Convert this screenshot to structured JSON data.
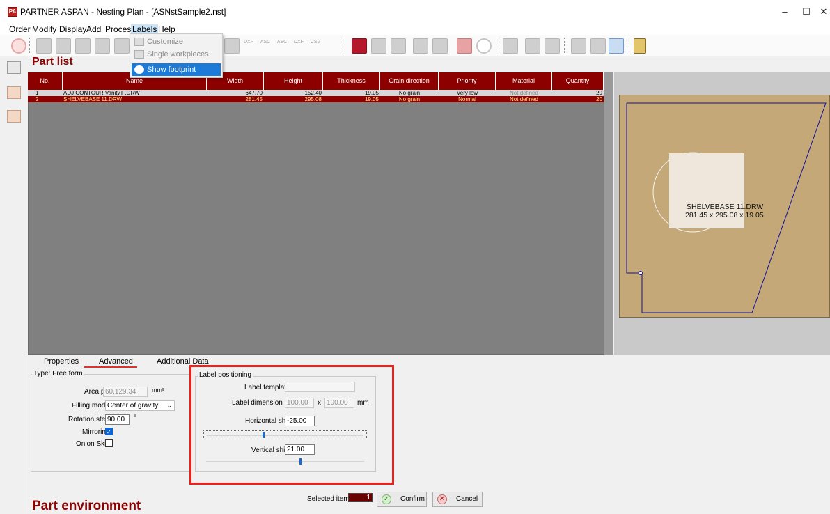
{
  "window": {
    "title": "PARTNER ASPAN - Nesting Plan - [ASNstSample2.nst]",
    "app_icon": "PA",
    "controls": {
      "minimize": "–",
      "maximize": "☐",
      "close": "✕"
    }
  },
  "menu": [
    "Order",
    "Modify",
    "Display",
    "Add",
    "Process",
    "Labels",
    "Help"
  ],
  "dropdown": {
    "items": [
      {
        "label": "Customize",
        "state": "disabled",
        "icon": "pencil-icon"
      },
      {
        "label": "Single workpieces",
        "state": "disabled",
        "icon": "workpiece-icon"
      },
      {
        "label": "Show footprint",
        "state": "highlighted",
        "icon": "eye-icon"
      }
    ],
    "highlight_color": "#1e7ad7"
  },
  "toolbar": {
    "text_buttons": [
      "DXF",
      "ASC",
      "ASC",
      "DXF",
      "CSV"
    ]
  },
  "part_list": {
    "title": "Part list",
    "columns": [
      "No.",
      "Name",
      "Width",
      "Height",
      "Thickness",
      "Grain direction",
      "Priority",
      "Material",
      "Quantity"
    ],
    "rows": [
      {
        "no": "1",
        "name": "ADJ CONTOUR VanityT .DRW",
        "width": "647.70",
        "height": "152.40",
        "thickness": "19.05",
        "grain": "No grain",
        "priority": "Very low",
        "material": "Not defined",
        "quantity": "20"
      },
      {
        "no": "2",
        "name": "SHELVEBASE 11.DRW",
        "width": "281.45",
        "height": "295.08",
        "thickness": "19.05",
        "grain": "No grain",
        "priority": "Normal",
        "material": "Not defined",
        "quantity": "20"
      }
    ],
    "header_color": "#8c0000",
    "selected_row_color": "#8c0000"
  },
  "preview": {
    "label_name": "SHELVEBASE 11.DRW",
    "label_dims": "281.45 x 295.08 x 19.05",
    "panel_color": "#c4a877",
    "outline_color": "#1010a0"
  },
  "tabs": [
    "Properties",
    "Advanced",
    "Additional Data"
  ],
  "properties": {
    "type": "Type: Free form",
    "area_label": "Area piece",
    "area_value": "60,129.34",
    "area_unit": "mm²",
    "filling_label": "Filling mode",
    "filling_value": "Center of gravity",
    "rotation_label": "Rotation step",
    "rotation_value": "90.00",
    "rotation_unit": "°",
    "mirroring_label": "Mirroring",
    "mirroring_checked": true,
    "onion_label": "Onion Skin",
    "onion_checked": false
  },
  "label_positioning": {
    "group_title": "Label positioning",
    "template_label": "Label template",
    "template_value": "",
    "dimension_label": "Label dimension",
    "dim_w": "100.00",
    "dim_sep": "x",
    "dim_h": "100.00",
    "dim_unit": "mm",
    "hshift_label": "Horizontal shift",
    "hshift_value": "-25.00",
    "vshift_label": "Vertical shift",
    "vshift_value": "21.00"
  },
  "footer": {
    "env_title": "Part environment",
    "selected_label": "Selected items",
    "selected_value": "1",
    "confirm": "Confirm",
    "cancel": "Cancel"
  }
}
